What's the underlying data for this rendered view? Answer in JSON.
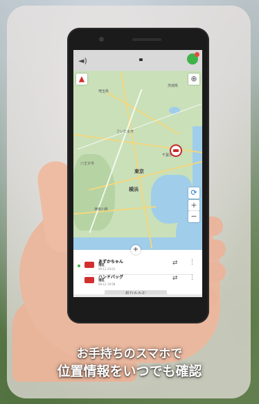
{
  "map": {
    "labels": {
      "city_main": "東京",
      "city_sub": "横浜",
      "area_nw": "埼玉県",
      "area_mid": "さいたま市",
      "area_w": "八王子市",
      "area_sw": "神奈川県",
      "area_e": "千葉市",
      "area_n": "茨城県"
    },
    "zoom_in": "+",
    "zoom_out": "−"
  },
  "panel": {
    "add_label": "+",
    "devices": [
      {
        "name": "あずかちゃん",
        "location": "港区",
        "time": "09-12 20:01",
        "action": "⇄",
        "more": "⋮"
      },
      {
        "name": "ハンドバッグ",
        "location": "港区",
        "time": "09-12 19:58",
        "action": "⇄",
        "more": "⋮"
      }
    ],
    "collapse_label": "折りたたむ"
  },
  "status": {
    "sound_icon": "◄)"
  },
  "caption": {
    "line1": "お手持ちのスマホで",
    "line2": "位置情報をいつでも確認"
  },
  "colors": {
    "accent": "#3fb34a",
    "marker": "#c62828"
  }
}
